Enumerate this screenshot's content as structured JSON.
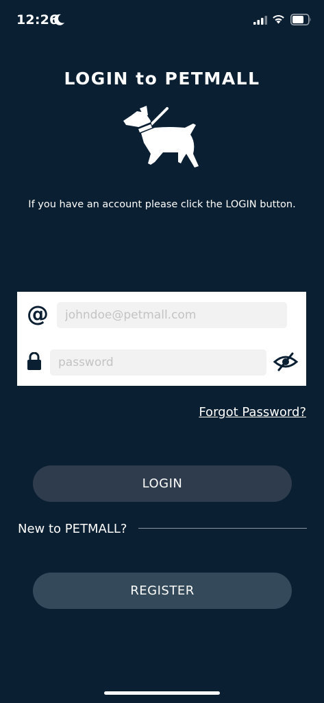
{
  "status_bar": {
    "time": "12:26"
  },
  "header": {
    "title": "LOGIN to PETMALL",
    "subtitle": "If you have an account please click the LOGIN button."
  },
  "form": {
    "email_placeholder": "johndoe@petmall.com",
    "email_value": "",
    "password_placeholder": "password",
    "password_value": "",
    "email_icon": "@"
  },
  "links": {
    "forgot_password": "Forgot Password?"
  },
  "buttons": {
    "login": "LOGIN",
    "register": "REGISTER"
  },
  "register_section": {
    "prompt": "New to PETMALL?"
  },
  "icons": {
    "moon": "moon-icon",
    "signal": "cellular-signal-icon",
    "wifi": "wifi-icon",
    "battery": "battery-icon",
    "logo": "dog-icon",
    "email": "at-icon",
    "lock": "lock-icon",
    "toggle": "eye-slash-icon"
  },
  "colors": {
    "background": "#0b1f33",
    "card": "#ffffff",
    "login_button": "#2f3c4d",
    "register_button": "#344a5a"
  }
}
